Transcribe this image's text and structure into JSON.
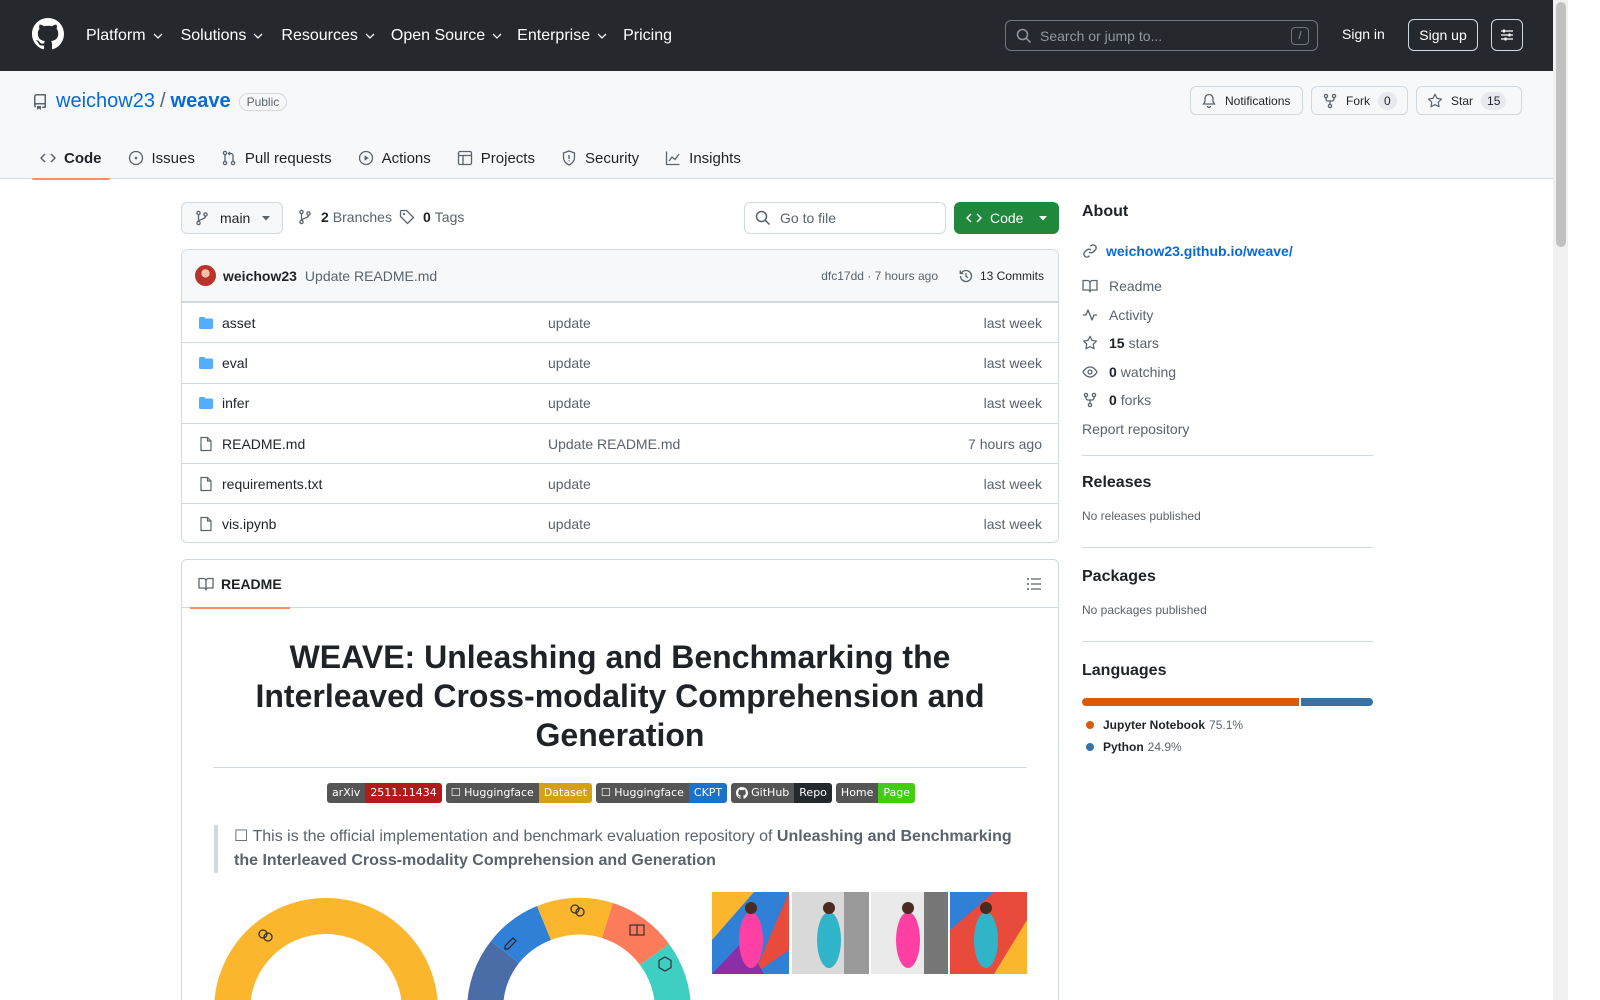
{
  "header": {
    "nav": [
      "Platform",
      "Solutions",
      "Resources",
      "Open Source",
      "Enterprise",
      "Pricing"
    ],
    "search_placeholder": "Search or jump to...",
    "search_shortcut": "/",
    "sign_in": "Sign in",
    "sign_up": "Sign up"
  },
  "repo": {
    "owner": "weichow23",
    "separator": "/",
    "name": "weave",
    "visibility": "Public",
    "notifications_label": "Notifications",
    "fork_label": "Fork",
    "fork_count": "0",
    "star_label": "Star",
    "star_count": "15",
    "tabs": [
      "Code",
      "Issues",
      "Pull requests",
      "Actions",
      "Projects",
      "Security",
      "Insights"
    ]
  },
  "browser": {
    "branch": "main",
    "branches_count": "2",
    "branches_label": "Branches",
    "tags_count": "0",
    "tags_label": "Tags",
    "goto_placeholder": "Go to file",
    "code_label": "Code",
    "commit": {
      "author": "weichow23",
      "message": "Update README.md",
      "hash_time": "dfc17dd · 7 hours ago",
      "commits_label": "13 Commits"
    },
    "files": [
      {
        "name": "asset",
        "type": "dir",
        "message": "update",
        "time": "last week"
      },
      {
        "name": "eval",
        "type": "dir",
        "message": "update",
        "time": "last week"
      },
      {
        "name": "infer",
        "type": "dir",
        "message": "update",
        "time": "last week"
      },
      {
        "name": "README.md",
        "type": "file",
        "message": "Update README.md",
        "time": "7 hours ago"
      },
      {
        "name": "requirements.txt",
        "type": "file",
        "message": "update",
        "time": "last week"
      },
      {
        "name": "vis.ipynb",
        "type": "file",
        "message": "update",
        "time": "last week"
      }
    ]
  },
  "readme": {
    "tab_label": "README",
    "title": "WEAVE: Unleashing and Benchmarking the Interleaved Cross-modality Comprehension and Generation",
    "badges": [
      {
        "left": "arXiv",
        "right": "2511.11434",
        "color": "#b31b1b"
      },
      {
        "left": "☐ Huggingface",
        "right": "Dataset",
        "color": "#d4a017"
      },
      {
        "left": "☐ Huggingface",
        "right": "CKPT",
        "color": "#1a73c9"
      },
      {
        "left": "GitHub",
        "right": "Repo",
        "color": "#24292e"
      },
      {
        "left": "Home",
        "right": "Page",
        "color": "#44cc11"
      }
    ],
    "quote_prefix": "☐ This is the official implementation and benchmark evaluation repository of ",
    "quote_bold": "Unleashing and Benchmarking the Interleaved Cross-modality Comprehension and Generation"
  },
  "sidebar": {
    "about_heading": "About",
    "website": "weichow23.github.io/weave/",
    "readme": "Readme",
    "activity": "Activity",
    "stars_count": "15",
    "stars_label": "stars",
    "watching_count": "0",
    "watching_label": "watching",
    "forks_count": "0",
    "forks_label": "forks",
    "report": "Report repository",
    "releases_heading": "Releases",
    "releases_text": "No releases published",
    "packages_heading": "Packages",
    "packages_text": "No packages published",
    "languages_heading": "Languages",
    "languages": [
      {
        "name": "Jupyter Notebook",
        "percent": "75.1%",
        "value": 75.1,
        "color": "#DA5B0B"
      },
      {
        "name": "Python",
        "percent": "24.9%",
        "value": 24.9,
        "color": "#3572A5"
      }
    ]
  }
}
